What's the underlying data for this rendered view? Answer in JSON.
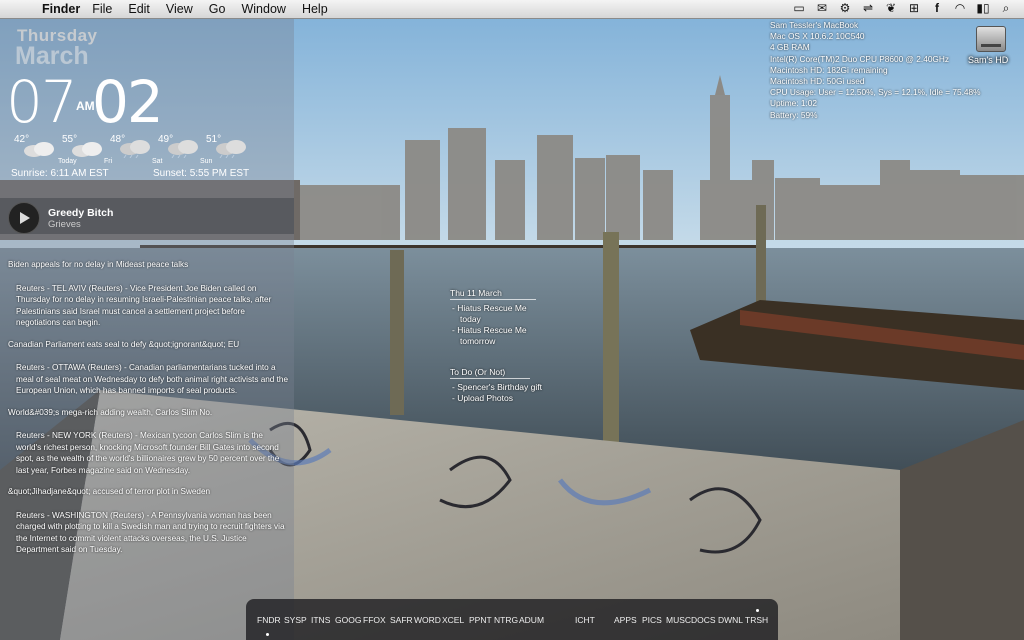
{
  "menubar": {
    "app_name": "Finder",
    "menus": [
      "File",
      "Edit",
      "View",
      "Go",
      "Window",
      "Help"
    ]
  },
  "clock": {
    "day": "Thursday",
    "month": "March",
    "hour": "07",
    "ampm": "AM",
    "minute": "02"
  },
  "weather": [
    {
      "temp": "42°",
      "label": ""
    },
    {
      "temp": "55°",
      "label": "Today"
    },
    {
      "temp": "48°",
      "label": "Fri"
    },
    {
      "temp": "49°",
      "label": "Sat"
    },
    {
      "temp": "51°",
      "label": "Sun"
    }
  ],
  "sun": {
    "sunrise": "Sunrise: 6:11 AM EST",
    "sunset": "Sunset: 5:55 PM EST"
  },
  "now_playing": {
    "title": "Greedy Bitch",
    "artist": "Grieves"
  },
  "news": [
    {
      "headline": "Biden appeals for no delay in Mideast peace talks",
      "body": "Reuters - TEL AVIV (Reuters) - Vice President Joe Biden called on Thursday for no delay in resuming Israeli-Palestinian peace talks, after Palestinians said Israel must cancel a settlement project before negotiations can begin."
    },
    {
      "headline": "Canadian Parliament eats seal to defy &quot;ignorant&quot; EU",
      "body": "Reuters - OTTAWA (Reuters) - Canadian parliamentarians tucked into a meal of seal meat on Wednesday to defy both animal right activists and the European Union, which has banned imports of seal products."
    },
    {
      "headline": "World&#039;s mega-rich adding wealth, Carlos Slim No.",
      "body": "Reuters - NEW YORK (Reuters) - Mexican tycoon Carlos Slim is the world's richest person, knocking Microsoft founder Bill Gates into second spot, as the wealth of the world's billionaires grew by 50 percent over the last year, Forbes magazine said on Wednesday."
    },
    {
      "headline": "&quot;Jihadjane&quot; accused of terror plot in Sweden",
      "body": "Reuters - WASHINGTON (Reuters) - A Pennsylvania woman has been charged with plotting to kill a Swedish man and trying to recruit fighters via the Internet to commit violent attacks overseas, the U.S. Justice Department said on Tuesday."
    }
  ],
  "calendar": {
    "date": "Thu 11 March",
    "events": [
      "- Hiatus Rescue Me",
      "   today",
      "- Hiatus Rescue Me",
      "   tomorrow"
    ],
    "todo_title": "To Do (Or Not)",
    "todos": [
      "- Spencer's Birthday gift",
      "- Upload Photos"
    ]
  },
  "sysinfo": [
    "Sam Tessler's MacBook",
    "Mac OS X 10.6.2 10C540",
    "4 GB RAM",
    "Intel(R) Core(TM)2 Duo CPU     P8600  @ 2.40GHz",
    "Macintosh HD: 182Gi remaining",
    "Macintosh HD: 50Gi used",
    "CPU Usage:  User = 12.50%, Sys = 12.1%, Idle = 75.48%",
    "Uptime: 1:02",
    "Battery: 59%"
  ],
  "desktop": {
    "hd_label": "Sam's HD"
  },
  "dock": [
    "FNDR",
    "SYSP",
    "ITNS",
    "GOOG",
    "FFOX",
    "SAFR",
    "WORD",
    "XCEL",
    "PPNT",
    "NTRG",
    "ADUM",
    "ICHT",
    "APPS",
    "PICS",
    "MUSC",
    "DOCS",
    "DWNL",
    "TRSH"
  ],
  "menu_extras": [
    "display-icon",
    "mail-icon",
    "gear-icon",
    "sync-icon",
    "bird-icon",
    "plus-icon",
    "facebook-icon",
    "wifi-icon",
    "battery-icon",
    "spotlight-icon"
  ]
}
